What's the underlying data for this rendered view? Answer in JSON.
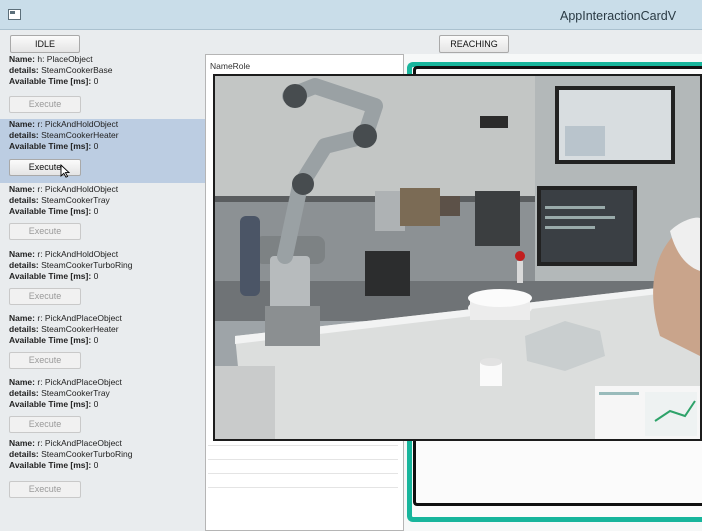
{
  "window": {
    "title": "AppInteractionCardV"
  },
  "states": {
    "idle_label": "IDLE",
    "reaching_label": "REACHING"
  },
  "labels": {
    "name": "Name:",
    "details": "details:",
    "available_time": "Available Time [ms]:"
  },
  "namerole": {
    "header": "NameRole"
  },
  "tasks": [
    {
      "name": "h: PlaceObject",
      "details": "SteamCookerBase",
      "time": "0",
      "execute_label": "Execute",
      "enabled": false,
      "selected": false
    },
    {
      "name": "r: PickAndHoldObject",
      "details": "SteamCookerHeater",
      "time": "0",
      "execute_label": "Execute",
      "enabled": true,
      "selected": true
    },
    {
      "name": "r: PickAndHoldObject",
      "details": "SteamCookerTray",
      "time": "0",
      "execute_label": "Execute",
      "enabled": false,
      "selected": false
    },
    {
      "name": "r: PickAndHoldObject",
      "details": "SteamCookerTurboRing",
      "time": "0",
      "execute_label": "Execute",
      "enabled": false,
      "selected": false
    },
    {
      "name": "r: PickAndPlaceObject",
      "details": "SteamCookerHeater",
      "time": "0",
      "execute_label": "Execute",
      "enabled": false,
      "selected": false
    },
    {
      "name": "r: PickAndPlaceObject",
      "details": "SteamCookerTray",
      "time": "0",
      "execute_label": "Execute",
      "enabled": false,
      "selected": false
    },
    {
      "name": "r: PickAndPlaceObject",
      "details": "SteamCookerTurboRing",
      "time": "0",
      "execute_label": "Execute",
      "enabled": false,
      "selected": false
    }
  ],
  "colors": {
    "accent": "#18b59c",
    "selection": "#bccde2",
    "titlebar": "#c9dde9"
  },
  "icons": {
    "app": "window-icon",
    "cursor": "mouse-pointer-icon"
  }
}
